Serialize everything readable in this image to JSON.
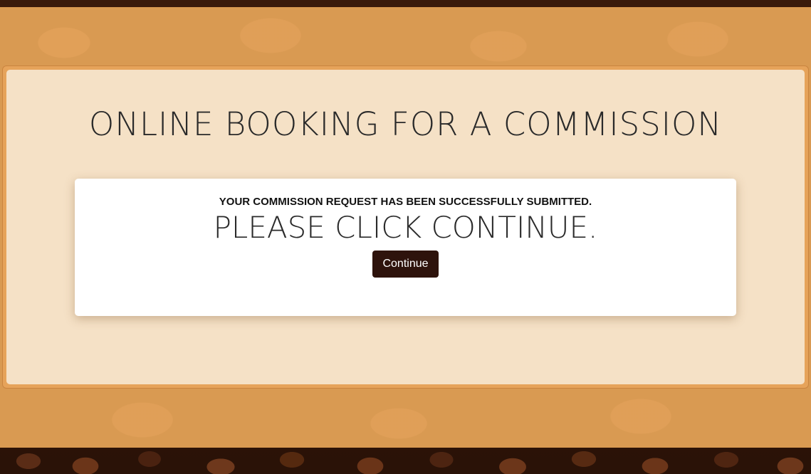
{
  "page": {
    "title": "ONLINE BOOKING FOR A COMMISSION"
  },
  "confirmation": {
    "success_message": "YOUR COMMISSION REQUEST HAS BEEN SUCCESSFULLY SUBMITTED.",
    "instruction": "PLEASE CLICK CONTINUE.",
    "continue_label": "Continue"
  },
  "colors": {
    "band": "#d99a52",
    "panel": "#f5e1c6",
    "button": "#2e130c",
    "background": "#2a1207"
  }
}
